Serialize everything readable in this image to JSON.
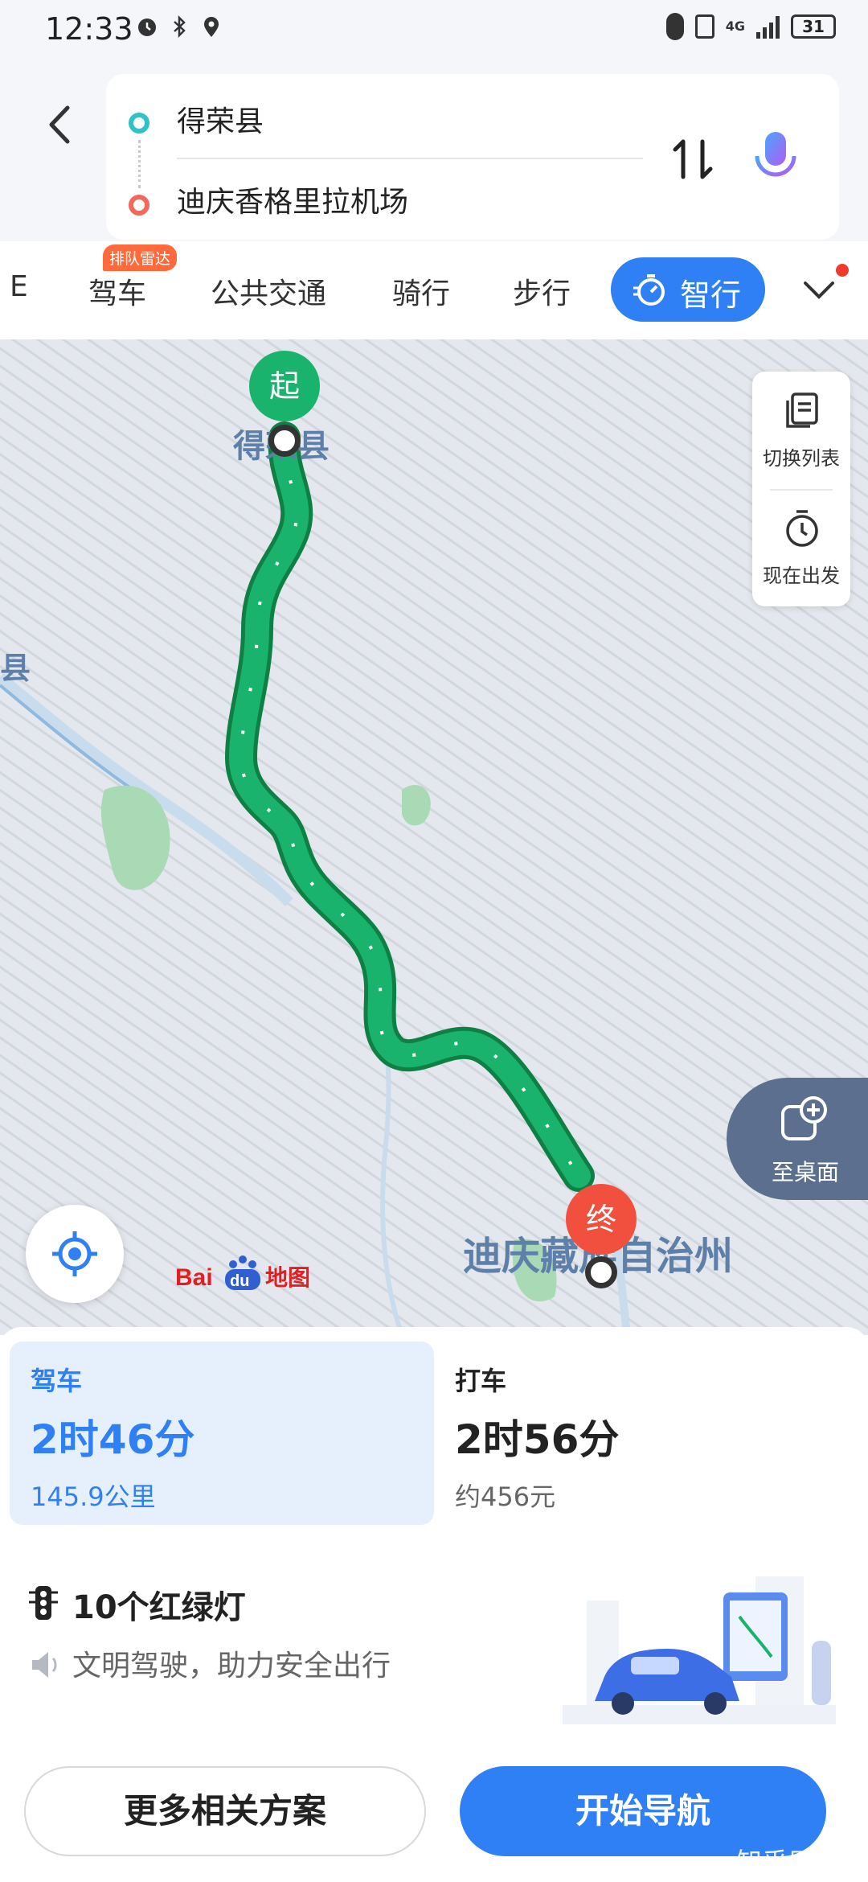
{
  "status_bar": {
    "time": "12:33",
    "network": "4G",
    "battery": "31"
  },
  "search": {
    "from": "得荣县",
    "to": "迪庆香格里拉机场"
  },
  "tabs": {
    "partial": "E",
    "drive": "驾车",
    "drive_badge": "排队雷达",
    "transit": "公共交通",
    "ride": "骑行",
    "walk": "步行",
    "smart": "智行"
  },
  "map": {
    "label_start_county": "得荣县",
    "label_left_county": "县",
    "label_region": "迪庆藏族自治州",
    "start_marker": "起",
    "end_marker": "终",
    "side_switch_list": "切换列表",
    "side_depart_now": "现在出发",
    "desktop_button": "至桌面",
    "logo_text": "Bai du 地图",
    "route_color": "#19b36e"
  },
  "plans": {
    "drive": {
      "title": "驾车",
      "duration": "2时46分",
      "distance": "145.9公里"
    },
    "taxi": {
      "title": "打车",
      "duration": "2时56分",
      "price": "约456元"
    }
  },
  "route_info": {
    "traffic_lights": "10个红绿灯",
    "tip": "文明驾驶，助力安全出行"
  },
  "actions": {
    "more_plans": "更多相关方案",
    "start_nav": "开始导航"
  },
  "watermark": "知乎用户",
  "colors": {
    "accent": "#2f7ff5",
    "start": "#19b36e",
    "end": "#f2503f"
  }
}
